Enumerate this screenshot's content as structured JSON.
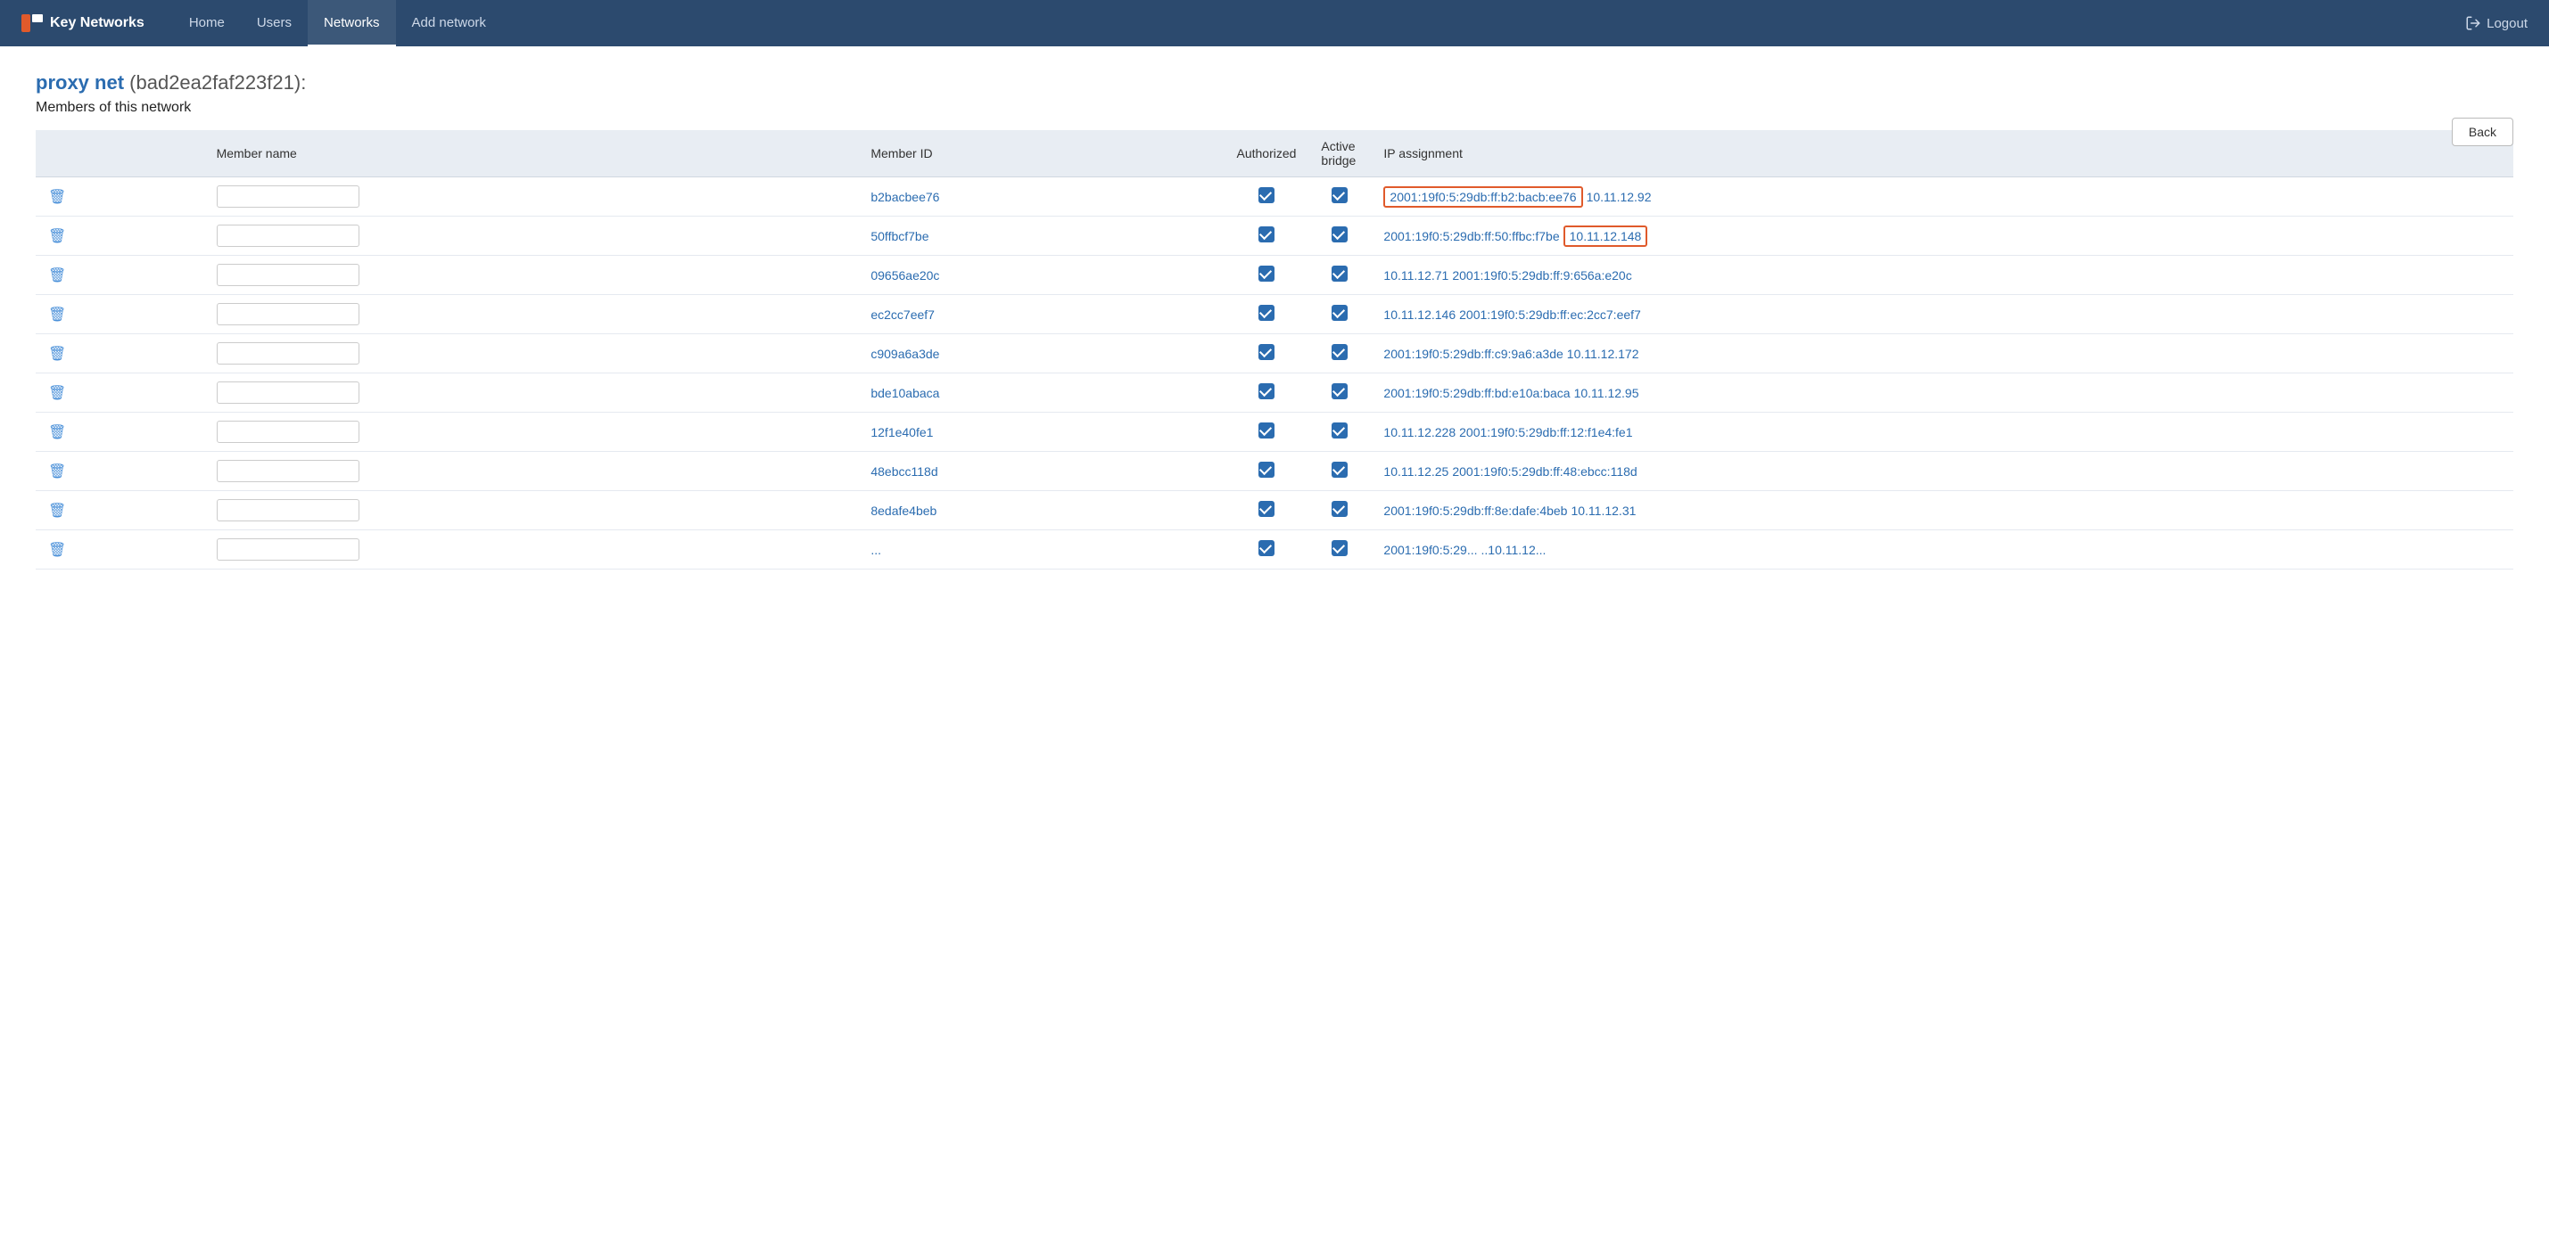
{
  "nav": {
    "brand": "Key Networks",
    "links": [
      {
        "label": "Home",
        "active": false,
        "name": "home"
      },
      {
        "label": "Users",
        "active": false,
        "name": "users"
      },
      {
        "label": "Networks",
        "active": true,
        "name": "networks"
      },
      {
        "label": "Add network",
        "active": false,
        "name": "add-network"
      }
    ],
    "logout_label": "Logout"
  },
  "page": {
    "network_name": "proxy net",
    "network_id": "(bad2ea2faf223f21):",
    "section_title": "Members of this network",
    "back_label": "Back"
  },
  "table": {
    "columns": [
      "",
      "Member name",
      "Member ID",
      "Authorized",
      "Active bridge",
      "IP assignment"
    ],
    "rows": [
      {
        "member_id": "b2bacbee76",
        "member_name": "",
        "authorized": true,
        "active_bridge": true,
        "ips": [
          {
            "value": "2001:19f0:5:29db:ff:b2:bacb:ee76",
            "highlight": true
          },
          {
            "value": "10.11.12.92",
            "highlight": false
          }
        ]
      },
      {
        "member_id": "50ffbcf7be",
        "member_name": "",
        "authorized": true,
        "active_bridge": true,
        "ips": [
          {
            "value": "2001:19f0:5:29db:ff:50:ffbc:f7be",
            "highlight": false
          },
          {
            "value": "10.11.12.148",
            "highlight": true
          }
        ]
      },
      {
        "member_id": "09656ae20c",
        "member_name": "",
        "authorized": true,
        "active_bridge": true,
        "ips": [
          {
            "value": "10.11.12.71",
            "highlight": false
          },
          {
            "value": "2001:19f0:5:29db:ff:9:656a:e20c",
            "highlight": false
          }
        ]
      },
      {
        "member_id": "ec2cc7eef7",
        "member_name": "",
        "authorized": true,
        "active_bridge": true,
        "ips": [
          {
            "value": "10.11.12.146",
            "highlight": false
          },
          {
            "value": "2001:19f0:5:29db:ff:ec:2cc7:eef7",
            "highlight": false
          }
        ]
      },
      {
        "member_id": "c909a6a3de",
        "member_name": "",
        "authorized": true,
        "active_bridge": true,
        "ips": [
          {
            "value": "2001:19f0:5:29db:ff:c9:9a6:a3de",
            "highlight": false
          },
          {
            "value": "10.11.12.172",
            "highlight": false
          }
        ]
      },
      {
        "member_id": "bde10abaca",
        "member_name": "",
        "authorized": true,
        "active_bridge": true,
        "ips": [
          {
            "value": "2001:19f0:5:29db:ff:bd:e10a:baca",
            "highlight": false
          },
          {
            "value": "10.11.12.95",
            "highlight": false
          }
        ]
      },
      {
        "member_id": "12f1e40fe1",
        "member_name": "",
        "authorized": true,
        "active_bridge": true,
        "ips": [
          {
            "value": "10.11.12.228",
            "highlight": false
          },
          {
            "value": "2001:19f0:5:29db:ff:12:f1e4:fe1",
            "highlight": false
          }
        ]
      },
      {
        "member_id": "48ebcc118d",
        "member_name": "",
        "authorized": true,
        "active_bridge": true,
        "ips": [
          {
            "value": "10.11.12.25",
            "highlight": false
          },
          {
            "value": "2001:19f0:5:29db:ff:48:ebcc:118d",
            "highlight": false
          }
        ]
      },
      {
        "member_id": "8edafe4beb",
        "member_name": "",
        "authorized": true,
        "active_bridge": true,
        "ips": [
          {
            "value": "2001:19f0:5:29db:ff:8e:dafe:4beb",
            "highlight": false
          },
          {
            "value": "10.11.12.31",
            "highlight": false
          }
        ]
      },
      {
        "member_id": "...",
        "member_name": "",
        "authorized": true,
        "active_bridge": true,
        "ips": [
          {
            "value": "2001:19f0:5:29...",
            "highlight": false
          },
          {
            "value": "..10.11.12...",
            "highlight": false
          }
        ]
      }
    ]
  },
  "colors": {
    "nav_bg": "#2c4a6e",
    "accent_blue": "#2b6cb0",
    "highlight_border": "#e05a2b"
  }
}
